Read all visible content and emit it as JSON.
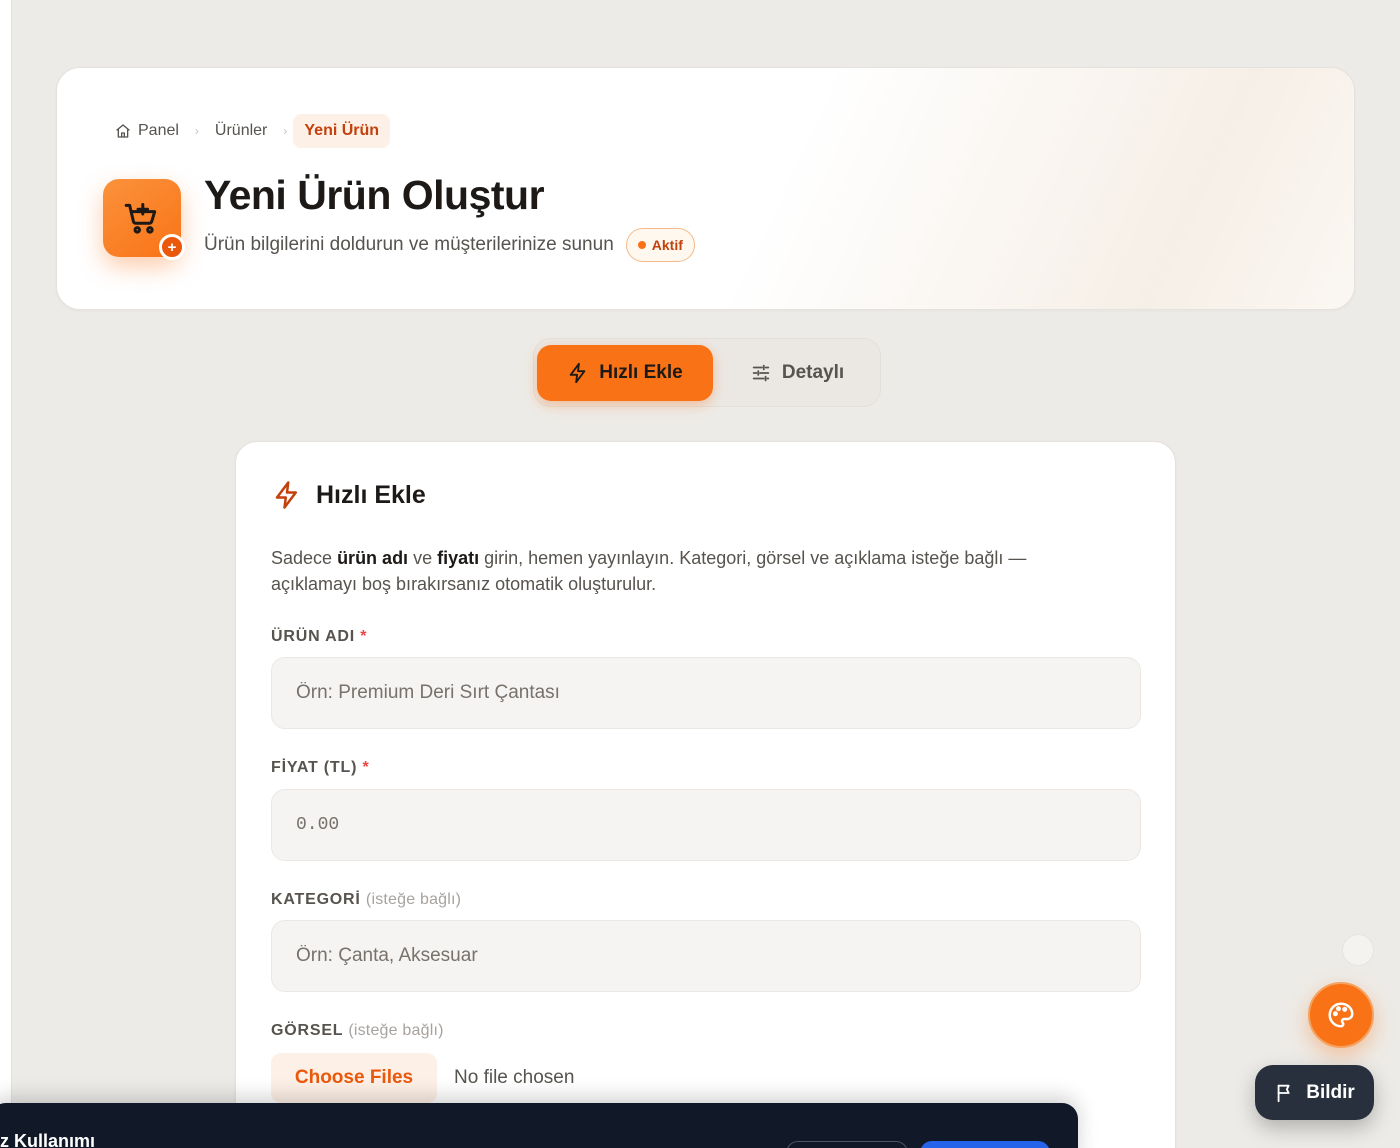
{
  "breadcrumb": {
    "home": "Panel",
    "products": "Ürünler",
    "current": "Yeni Ürün"
  },
  "header": {
    "title": "Yeni Ürün Oluştur",
    "subtitle": "Ürün bilgilerini doldurun ve müşterilerinize sunun",
    "status": "Aktif",
    "icon": "cart-plus-icon"
  },
  "modes": {
    "quick": "Hızlı Ekle",
    "detailed": "Detaylı",
    "active": "quick"
  },
  "form": {
    "title": "Hızlı Ekle",
    "desc_1": "Sadece ",
    "desc_bold_1": "ürün adı",
    "desc_2": " ve ",
    "desc_bold_2": "fiyatı",
    "desc_3": " girin, hemen yayınlayın. Kategori, görsel ve açıklama isteğe bağlı — açıklamayı boş bırakırsanız otomatik oluşturulur.",
    "name_label": "ÜRÜN ADI",
    "name_placeholder": "Örn: Premium Deri Sırt Çantası",
    "price_label": "FİYAT (TL)",
    "price_placeholder": "0.00",
    "category_label": "KATEGORİ",
    "category_placeholder": "Örn: Çanta, Aksesuar",
    "image_label": "GÖRSEL",
    "optional_text": "(isteğe bağlı)",
    "required_mark": "*",
    "file_button": "Choose Files",
    "file_status": "No file chosen"
  },
  "floating": {
    "report_label": "Bildir"
  },
  "cookie": {
    "title": "ez Kullanımı"
  },
  "colors": {
    "accent": "#f97316",
    "accent_dark": "#c2410c",
    "background": "#edebe7",
    "banner": "#111827"
  }
}
